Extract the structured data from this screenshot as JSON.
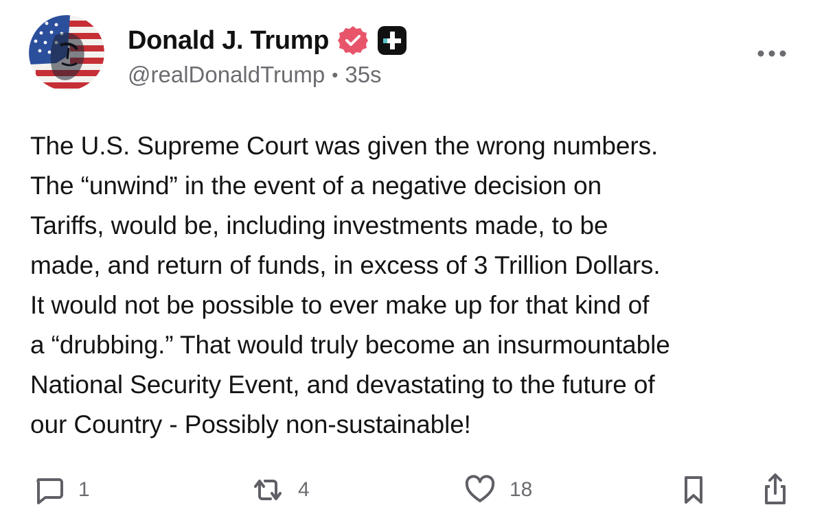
{
  "post": {
    "author": {
      "display_name": "Donald J. Trump",
      "handle": "@realDonaldTrump",
      "verified_icon": "verified-badge-icon",
      "verified_color": "#e8556b",
      "plus_badge_icon": "plus-badge-icon",
      "avatar": "profile-avatar-flag-portrait"
    },
    "timestamp_separator": "•",
    "timestamp": "35s",
    "more_icon": "more-horizontal-icon",
    "lines": [
      "The U.S. Supreme Court was given the wrong numbers.",
      "The “unwind” in the event of a negative decision on",
      "Tariffs, would be, including investments made, to be",
      "made, and return of funds, in excess of 3 Trillion Dollars.",
      "It would not be possible to ever make up for that kind of",
      "a “drubbing.” That would truly become an insurmountable",
      "National Security Event, and devastating to the future of",
      "our Country - Possibly non-sustainable!"
    ]
  },
  "actions": {
    "reply": {
      "icon": "comment-icon",
      "count": "1"
    },
    "repost": {
      "icon": "repost-icon",
      "count": "4"
    },
    "like": {
      "icon": "heart-icon",
      "count": "18"
    },
    "bookmark": {
      "icon": "bookmark-icon"
    },
    "share": {
      "icon": "share-icon"
    }
  },
  "colors": {
    "text": "#141414",
    "secondary_text": "#6b6b70",
    "icon": "#5f5f66"
  }
}
